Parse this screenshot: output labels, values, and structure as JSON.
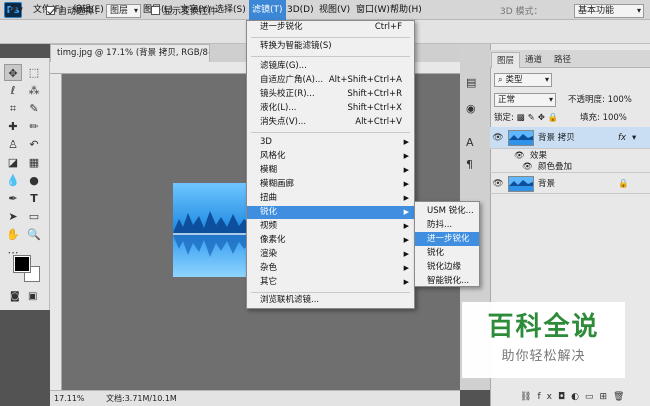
{
  "menubar": {
    "logo": "Ps",
    "items": [
      {
        "label": "文件(F)"
      },
      {
        "label": "编辑(E)"
      },
      {
        "label": "图像(I)"
      },
      {
        "label": "图层(L)"
      },
      {
        "label": "文字(Y)"
      },
      {
        "label": "选择(S)"
      },
      {
        "label": "滤镜(T)"
      },
      {
        "label": "3D(D)"
      },
      {
        "label": "视图(V)"
      },
      {
        "label": "窗口(W)"
      },
      {
        "label": "帮助(H)"
      }
    ],
    "active_index": 6
  },
  "options": {
    "auto_select_label": "自动选择：",
    "auto_select_checked": true,
    "auto_select_value": "图层",
    "show_transform_label": "显示变换控件",
    "mode_3d_label": "3D 模式：",
    "workspace_value": "基本功能"
  },
  "document": {
    "tab_title": "timg.jpg @ 17.1% (背景 拷贝, RGB/8#) *",
    "zoom": "17.11%",
    "doc_info": "文档:3.71M/10.1M"
  },
  "filter_menu": {
    "top_items": [
      {
        "label": "进一步锐化",
        "shortcut": "Ctrl+F"
      },
      {
        "label": "转换为智能滤镜(S)",
        "shortcut": ""
      }
    ],
    "gallery_items": [
      {
        "label": "滤镜库(G)...",
        "shortcut": ""
      },
      {
        "label": "自适应广角(A)...",
        "shortcut": "Alt+Shift+Ctrl+A"
      },
      {
        "label": "镜头校正(R)...",
        "shortcut": "Shift+Ctrl+R"
      },
      {
        "label": "液化(L)...",
        "shortcut": "Shift+Ctrl+X"
      },
      {
        "label": "消失点(V)...",
        "shortcut": "Alt+Ctrl+V"
      }
    ],
    "submenu_items": [
      {
        "label": "3D"
      },
      {
        "label": "风格化"
      },
      {
        "label": "模糊"
      },
      {
        "label": "模糊画廊"
      },
      {
        "label": "扭曲"
      },
      {
        "label": "锐化"
      },
      {
        "label": "视频"
      },
      {
        "label": "像素化"
      },
      {
        "label": "渲染"
      },
      {
        "label": "杂色"
      },
      {
        "label": "其它"
      }
    ],
    "highlighted_index": 5,
    "browse_label": "浏览联机滤镜..."
  },
  "sharpen_menu": {
    "items": [
      {
        "label": "USM 锐化..."
      },
      {
        "label": "防抖..."
      },
      {
        "label": "进一步锐化"
      },
      {
        "label": "锐化"
      },
      {
        "label": "锐化边缘"
      },
      {
        "label": "智能锐化..."
      }
    ],
    "highlighted_index": 2
  },
  "layers_panel": {
    "tabs": [
      {
        "label": "图层"
      },
      {
        "label": "通道"
      },
      {
        "label": "路径"
      }
    ],
    "active_tab": 0,
    "kind_filter": "类型",
    "blend_mode": "正常",
    "opacity_label": "不透明度:",
    "opacity_value": "100%",
    "lock_label": "锁定:",
    "fill_label": "填充:",
    "fill_value": "100%",
    "layers": [
      {
        "name": "背景 拷贝",
        "fx": "fx"
      },
      {
        "name": "效果",
        "indent": 1
      },
      {
        "name": "颜色叠加",
        "indent": 2
      },
      {
        "name": "背景",
        "locked": true
      }
    ],
    "footer_icons": [
      "link-icon",
      "fx-icon",
      "mask-icon",
      "adjustment-icon",
      "folder-icon",
      "new-layer-icon",
      "trash-icon"
    ]
  },
  "watermark": {
    "title": "百科全说",
    "subtitle": "助你轻松解决"
  },
  "colors": {
    "accent": "#3f8ee0",
    "watermark_green": "#2e8b3a",
    "canvas_bg": "#6f6f6f"
  }
}
